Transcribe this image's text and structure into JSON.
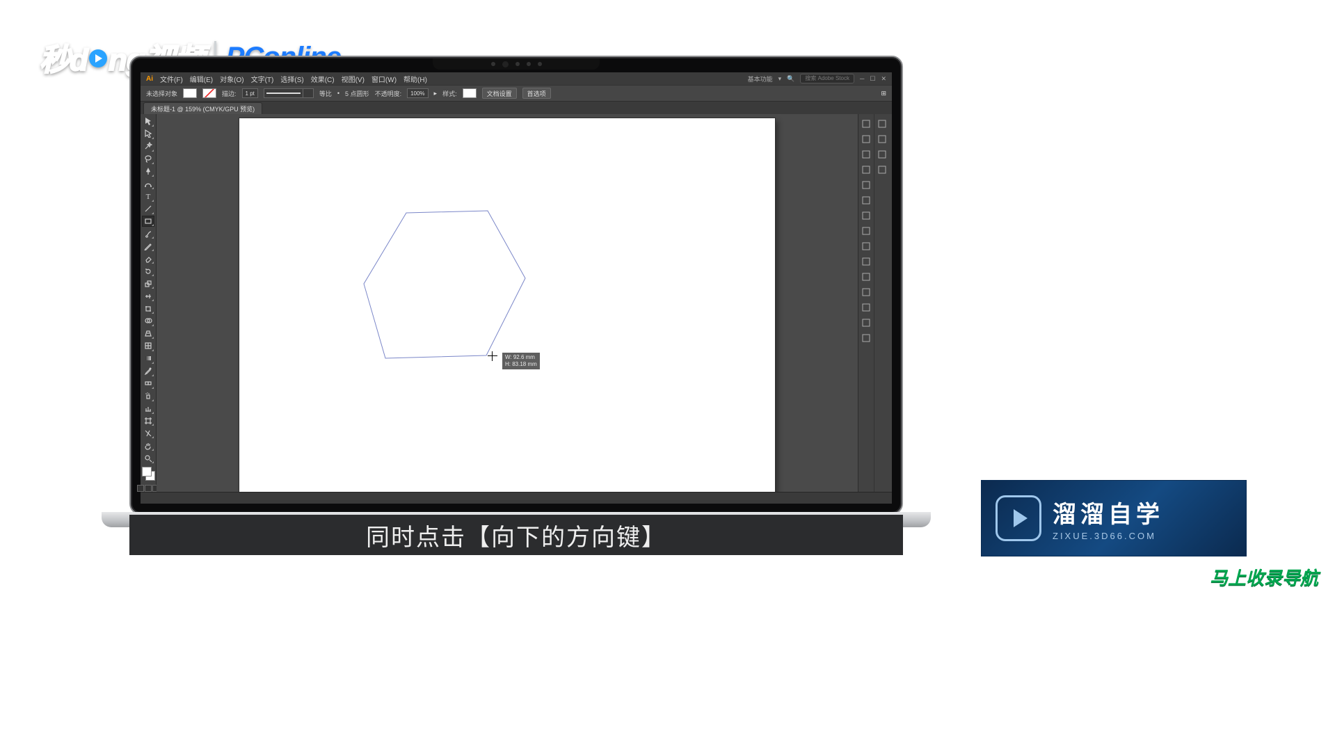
{
  "watermarks": {
    "miaodong_prefix": "秒d",
    "miaodong_suffix": "ng视频",
    "pconline": "PConline",
    "liuliu_title": "溜溜自学",
    "liuliu_url": "ZIXUE.3D66.COM",
    "nav_badge": "马上收录导航"
  },
  "menubar": {
    "logo": "Ai",
    "items": [
      "文件(F)",
      "编辑(E)",
      "对象(O)",
      "文字(T)",
      "选择(S)",
      "效果(C)",
      "视图(V)",
      "窗口(W)",
      "帮助(H)"
    ],
    "right_label": "基本功能",
    "search_placeholder": "搜索 Adobe Stock"
  },
  "optbar": {
    "left_label": "未选择对象",
    "stroke_label": "描边:",
    "stroke_weight": "1 pt",
    "stroke_style": "等比",
    "corner_label": "5 点圆形",
    "opacity_label": "不透明度:",
    "opacity_value": "100%",
    "style_label": "样式:",
    "doc_setup": "文档设置",
    "prefs": "首选项"
  },
  "tab": {
    "title": "未标题-1 @ 159% (CMYK/GPU 预览)"
  },
  "measurement": {
    "w": "W: 92.6 mm",
    "h": "H: 83.18 mm"
  },
  "subtitle": "同时点击【向下的方向键】",
  "tools": [
    {
      "name": "selection-tool",
      "glyph": "arrow"
    },
    {
      "name": "direct-selection-tool",
      "glyph": "arrow-white"
    },
    {
      "name": "magic-wand-tool",
      "glyph": "wand"
    },
    {
      "name": "lasso-tool",
      "glyph": "lasso"
    },
    {
      "name": "pen-tool",
      "glyph": "pen"
    },
    {
      "name": "curvature-tool",
      "glyph": "curve"
    },
    {
      "name": "type-tool",
      "glyph": "T"
    },
    {
      "name": "line-tool",
      "glyph": "line"
    },
    {
      "name": "rectangle-tool",
      "glyph": "rect",
      "selected": true
    },
    {
      "name": "paintbrush-tool",
      "glyph": "brush"
    },
    {
      "name": "shaper-tool",
      "glyph": "pencil"
    },
    {
      "name": "eraser-tool",
      "glyph": "eraser"
    },
    {
      "name": "rotate-tool",
      "glyph": "rotate"
    },
    {
      "name": "scale-tool",
      "glyph": "scale"
    },
    {
      "name": "width-tool",
      "glyph": "width"
    },
    {
      "name": "free-transform-tool",
      "glyph": "freetrans"
    },
    {
      "name": "shape-builder-tool",
      "glyph": "shapebuild"
    },
    {
      "name": "perspective-grid-tool",
      "glyph": "persp"
    },
    {
      "name": "mesh-tool",
      "glyph": "mesh"
    },
    {
      "name": "gradient-tool",
      "glyph": "gradient"
    },
    {
      "name": "eyedropper-tool",
      "glyph": "eyedrop"
    },
    {
      "name": "blend-tool",
      "glyph": "blend"
    },
    {
      "name": "symbol-sprayer-tool",
      "glyph": "spray"
    },
    {
      "name": "column-graph-tool",
      "glyph": "graph"
    },
    {
      "name": "artboard-tool",
      "glyph": "artboard"
    },
    {
      "name": "slice-tool",
      "glyph": "slice"
    },
    {
      "name": "hand-tool",
      "glyph": "hand"
    },
    {
      "name": "zoom-tool",
      "glyph": "zoom"
    }
  ],
  "panel_icons_col1": [
    "properties-icon",
    "character-icon",
    "color-mixer-icon",
    "color-guide-icon",
    "swatches-icon",
    "brushes-icon",
    "symbols-icon",
    "stroke-panel-icon",
    "gradient-panel-icon",
    "transparency-icon",
    "appearance-icon",
    "graphic-styles-icon",
    "layers-icon",
    "asset-export-icon",
    "artboards-icon"
  ],
  "panel_icons_col2": [
    "libraries-icon",
    "char-panel-icon",
    "paragraph-icon",
    "links-icon"
  ]
}
